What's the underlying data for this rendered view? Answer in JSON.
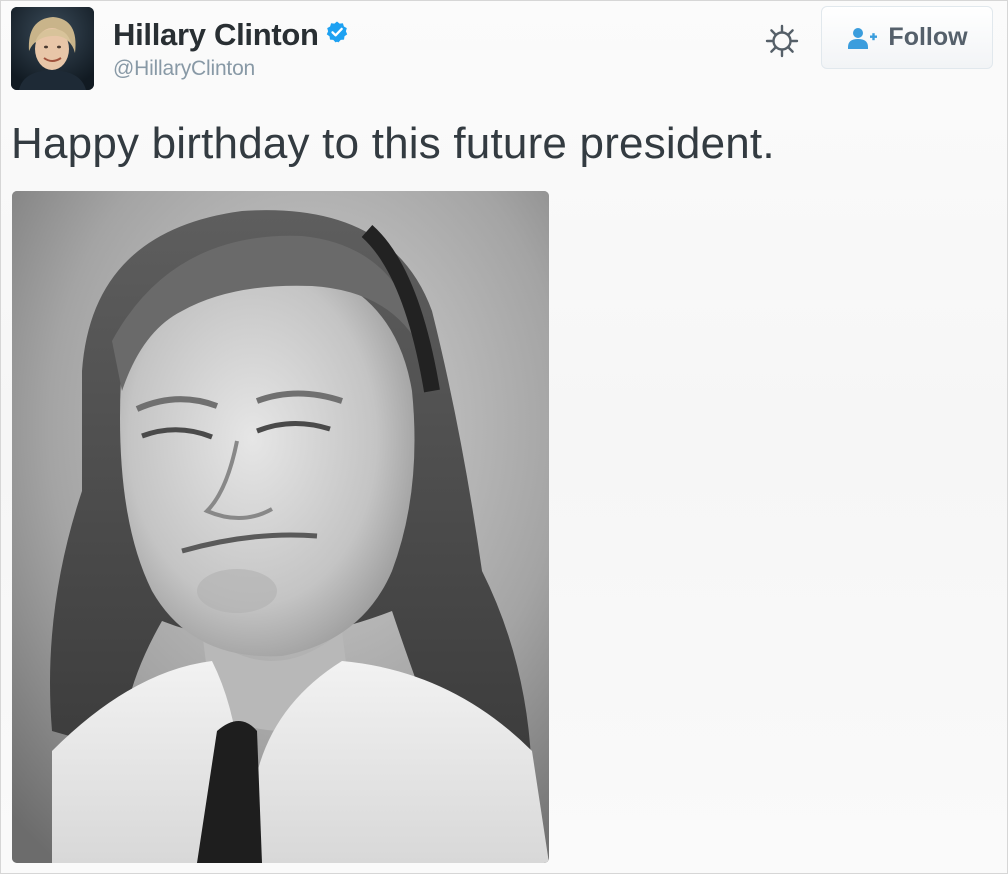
{
  "tweet": {
    "author": {
      "display_name": "Hillary Clinton",
      "handle": "@HillaryClinton",
      "verified": true,
      "avatar_icon": "profile-photo"
    },
    "text": "Happy birthday to this future president.",
    "media": {
      "type": "photo",
      "style": "black-and-white"
    }
  },
  "actions": {
    "settings_icon": "gear-icon",
    "follow_label": "Follow",
    "follow_icon": "add-user-icon"
  },
  "colors": {
    "verified_blue": "#1da1f2",
    "name_text": "#292f33",
    "handle_text": "#8899a6",
    "follow_icon_blue": "#3b9ddd"
  }
}
